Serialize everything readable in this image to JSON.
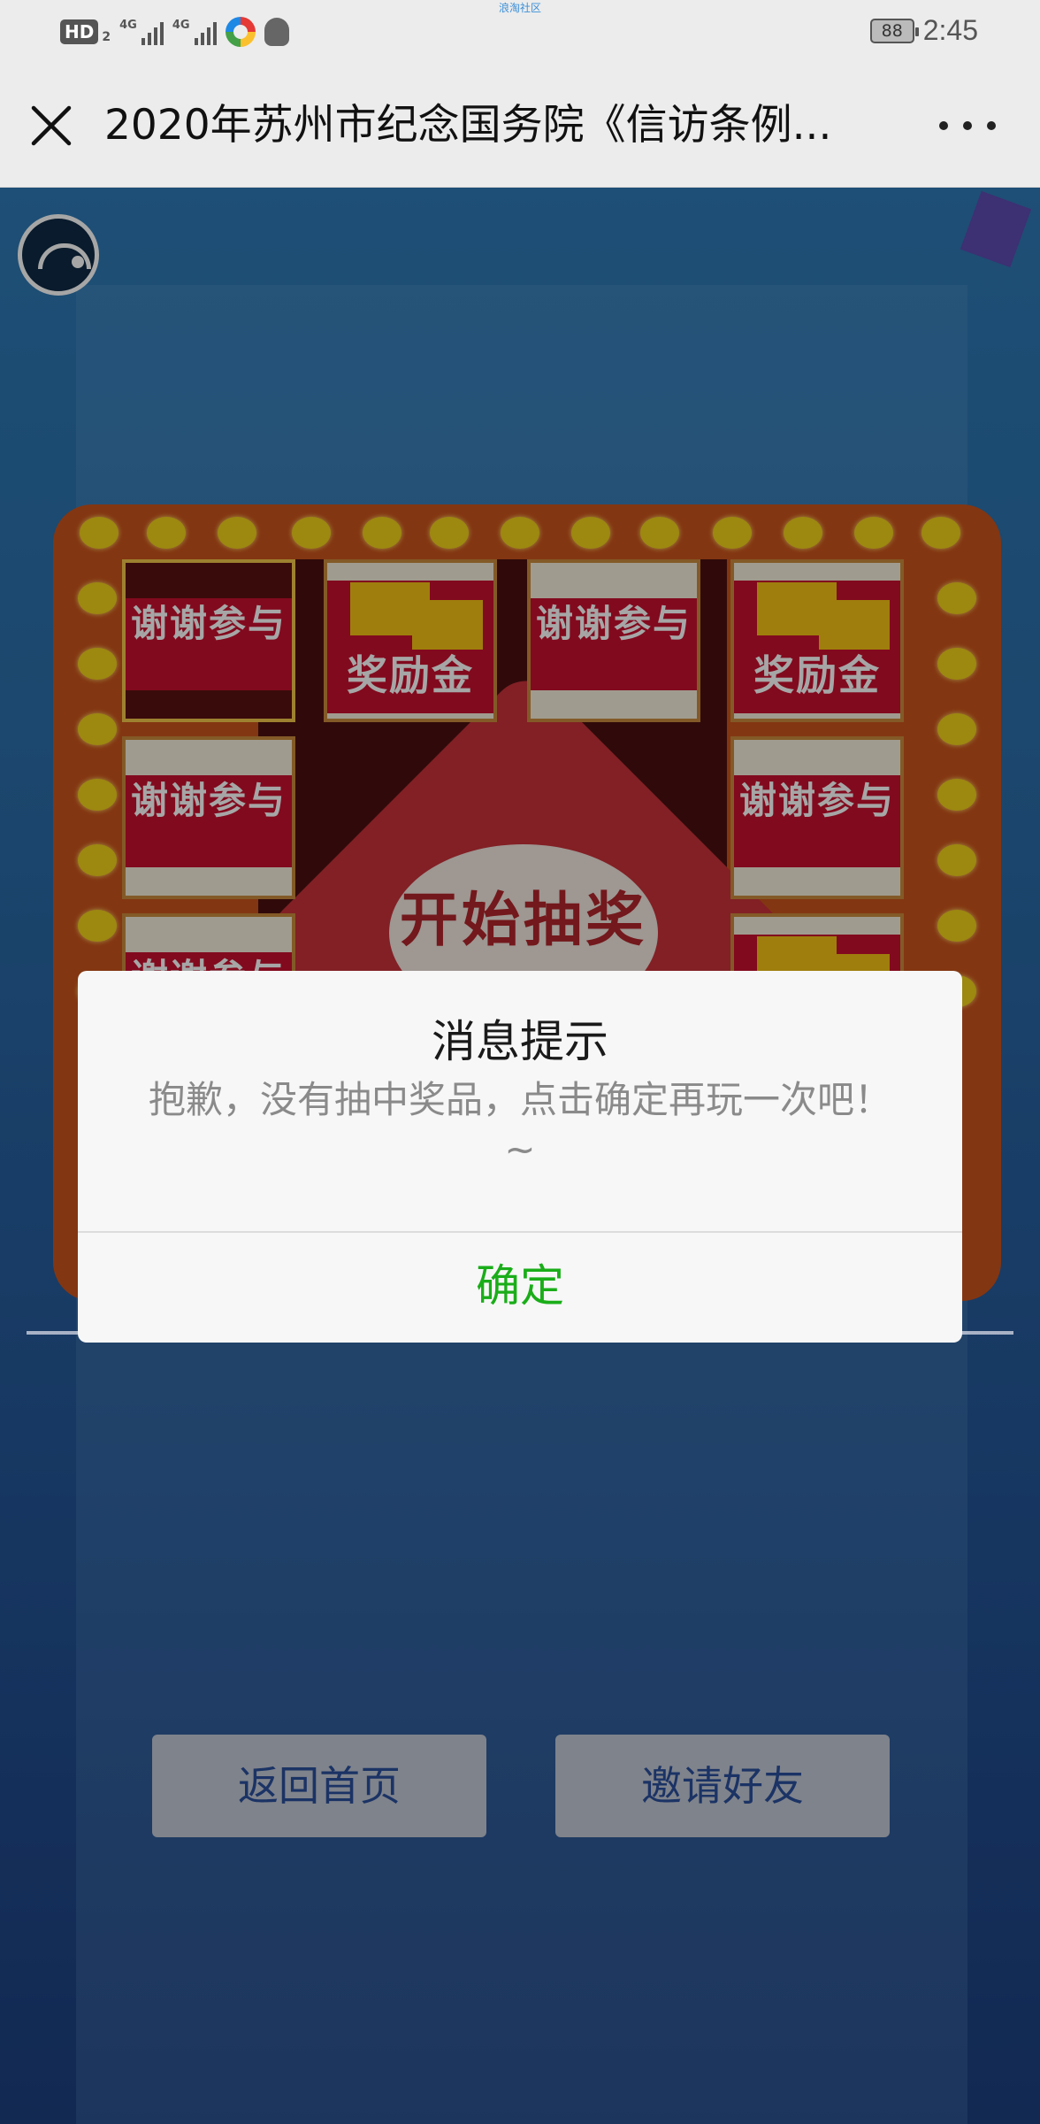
{
  "status_bar": {
    "hd_label": "HD",
    "hd_sub": "2",
    "signal1_label": "4G",
    "signal2_label": "4G",
    "center_text": "浪淘社区",
    "battery": "88",
    "time": "2:45"
  },
  "title_bar": {
    "title": "2020年苏州市纪念国务院《信访条例..."
  },
  "game": {
    "cells": [
      {
        "label": "谢谢参与",
        "type": "thanks",
        "active": true
      },
      {
        "label": "奖励金",
        "type": "reward",
        "active": false
      },
      {
        "label": "谢谢参与",
        "type": "thanks",
        "active": false
      },
      {
        "label": "奖励金",
        "type": "reward",
        "active": false
      },
      {
        "label": "谢谢参与",
        "type": "thanks",
        "active": false
      },
      {
        "label": "谢谢参与",
        "type": "thanks",
        "active": false
      },
      {
        "label": "谢谢参与",
        "type": "thanks",
        "active": false
      }
    ],
    "start_button": "开始抽奖"
  },
  "dialog": {
    "title": "消息提示",
    "message": "抱歉，没有抽中奖品，点击确定再玩一次吧！~",
    "ok_label": "确定",
    "ok_color": "#1aad19"
  },
  "bottom_buttons": {
    "home_label": "返回首页",
    "invite_label": "邀请好友"
  }
}
